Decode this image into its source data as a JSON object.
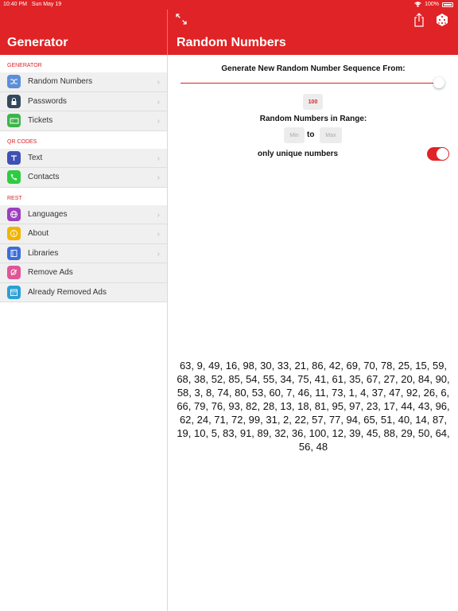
{
  "status": {
    "time": "10:40 PM",
    "date": "Sun May 19",
    "battery": "100%"
  },
  "sidebar": {
    "title": "Generator",
    "sections": [
      {
        "label": "GENERATOR",
        "items": [
          {
            "label": "Random Numbers",
            "icon": "shuffle-icon",
            "color": "#5b8fd9"
          },
          {
            "label": "Passwords",
            "icon": "lock-icon",
            "color": "#34495e"
          },
          {
            "label": "Tickets",
            "icon": "ticket-icon",
            "color": "#3cb54a"
          }
        ]
      },
      {
        "label": "QR CODES",
        "items": [
          {
            "label": "Text",
            "icon": "text-icon",
            "color": "#3f51b5"
          },
          {
            "label": "Contacts",
            "icon": "phone-icon",
            "color": "#2ecc40"
          }
        ]
      },
      {
        "label": "REST",
        "items": [
          {
            "label": "Languages",
            "icon": "globe-icon",
            "color": "#9b3fbf"
          },
          {
            "label": "About",
            "icon": "info-icon",
            "color": "#f0b400"
          },
          {
            "label": "Libraries",
            "icon": "book-icon",
            "color": "#3b6fd8"
          },
          {
            "label": "Remove Ads",
            "icon": "ad-icon",
            "color": "#e05597"
          },
          {
            "label": "Already Removed Ads",
            "icon": "calendar-icon",
            "color": "#2b9fd6"
          }
        ]
      }
    ]
  },
  "main": {
    "title": "Random Numbers",
    "heading": "Generate New Random Number Sequence From:",
    "count": "100",
    "slider_fraction": 0.97,
    "range_label": "Random Numbers in Range:",
    "min_placeholder": "Min",
    "to_label": "to",
    "max_placeholder": "Max",
    "unique_label": "only unique numbers",
    "unique_enabled": true,
    "numbers": "63, 9, 49, 16, 98, 30, 33, 21, 86, 42, 69, 70, 78, 25, 15, 59, 68, 38, 52, 85, 54, 55, 34, 75, 41, 61, 35, 67, 27, 20, 84, 90, 58, 3, 8, 74, 80, 53, 60, 7, 46, 11, 73, 1, 4, 37, 47, 92, 26, 6, 66, 79, 76, 93, 82, 28, 13, 18, 81, 95, 97, 23, 17, 44, 43, 96, 62, 24, 71, 72, 99, 31, 2, 22, 57, 77, 94, 65, 51, 40, 14, 87, 19, 10, 5, 83, 91, 89, 32, 36, 100, 12, 39, 45, 88, 29, 50, 64, 56, 48"
  },
  "colors": {
    "accent": "#e02326"
  }
}
